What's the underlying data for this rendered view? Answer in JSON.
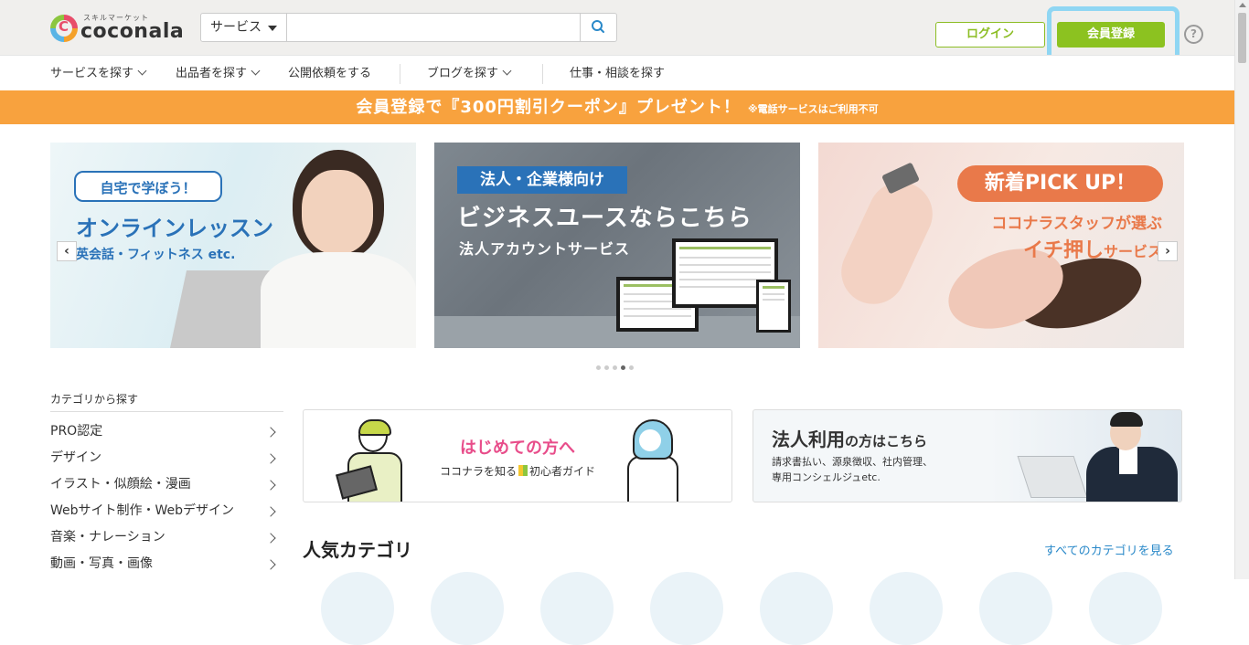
{
  "header": {
    "logo": {
      "sub": "スキルマーケット",
      "text": "coconala",
      "mark": "C"
    },
    "search": {
      "category": "サービス",
      "value": "",
      "placeholder": "",
      "icon": "search-icon"
    },
    "login_label": "ログイン",
    "register_label": "会員登録",
    "help_label": "?"
  },
  "nav": {
    "items": [
      {
        "label": "サービスを探す"
      },
      {
        "label": "出品者を探す"
      },
      {
        "label": "公開依頼をする"
      },
      {
        "label": "ブログを探す"
      },
      {
        "label": "仕事・相談を探す"
      }
    ]
  },
  "promo": {
    "main": "会員登録で『300円割引クーポン』プレゼント！",
    "note": "※電話サービスはご利用不可"
  },
  "carousel": {
    "prev": "‹",
    "next": "›",
    "slides": [
      {
        "pill": "自宅で学ぼう！",
        "title": "オンラインレッスン",
        "sub": "英会話・フィットネス etc."
      },
      {
        "badge": "法人・企業様向け",
        "title": "ビジネスユースならこちら",
        "sub": "法人アカウントサービス"
      },
      {
        "pill": "新着PICK UP！",
        "line1": "ココナラスタッフが選ぶ",
        "line2a": "イチ押し",
        "line2b": "サービス"
      }
    ],
    "dots": 5,
    "active_dot": 3
  },
  "categories": {
    "heading": "カテゴリから探す",
    "items": [
      {
        "label": "PRO認定"
      },
      {
        "label": "デザイン"
      },
      {
        "label": "イラスト・似顔絵・漫画"
      },
      {
        "label": "Webサイト制作・Webデザイン"
      },
      {
        "label": "音楽・ナレーション"
      },
      {
        "label": "動画・写真・画像"
      }
    ]
  },
  "cards": {
    "beginner": {
      "title": "はじめての方へ",
      "sub_a": "ココナラを知る",
      "sub_b": "初心者ガイド"
    },
    "business": {
      "title_a": "法人利用",
      "title_b": "の方はこちら",
      "desc1": "請求書払い、源泉徴収、社内管理、",
      "desc2": "専用コンシェルジュetc."
    }
  },
  "popular": {
    "title": "人気カテゴリ",
    "link": "すべてのカテゴリを見る"
  },
  "colors": {
    "brand_green": "#8cc220",
    "promo_orange": "#f8a23e",
    "accent_blue": "#2a72b8",
    "link_blue": "#2a89c9",
    "highlight": "#8fd6f3"
  }
}
